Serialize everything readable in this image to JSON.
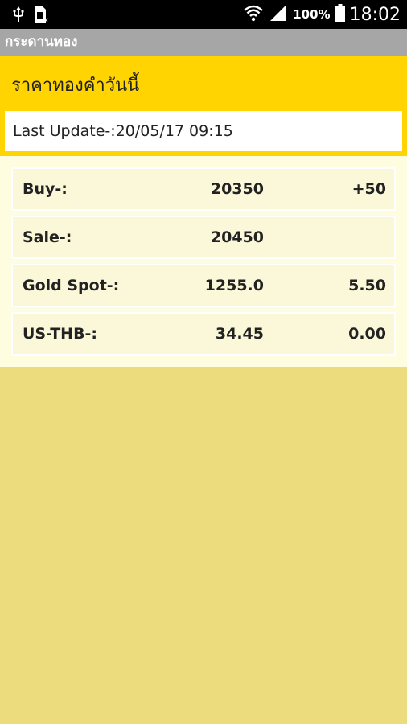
{
  "status_bar": {
    "battery_percent": "100%",
    "time": "18:02",
    "icons": [
      "usb-icon",
      "sim-icon",
      "wifi-icon",
      "signal-icon",
      "battery-icon"
    ]
  },
  "app": {
    "title": "กระดานทอง"
  },
  "header": {
    "title": "ราคาทองคำวันนี้",
    "last_update": "Last Update-:20/05/17 09:15"
  },
  "prices": [
    {
      "label": "Buy-:",
      "value": "20350",
      "change": "+50"
    },
    {
      "label": "Sale-:",
      "value": "20450",
      "change": ""
    },
    {
      "label": "Gold Spot-:",
      "value": "1255.0",
      "change": "5.50"
    },
    {
      "label": "US-THB-:",
      "value": "34.45",
      "change": "0.00"
    }
  ],
  "colors": {
    "header_yellow": "#FFD400",
    "panel_background": "#FFFDE0",
    "row_background": "#FAF8D8",
    "page_background": "#EDDC7E",
    "title_bar": "#A6A6A6"
  }
}
